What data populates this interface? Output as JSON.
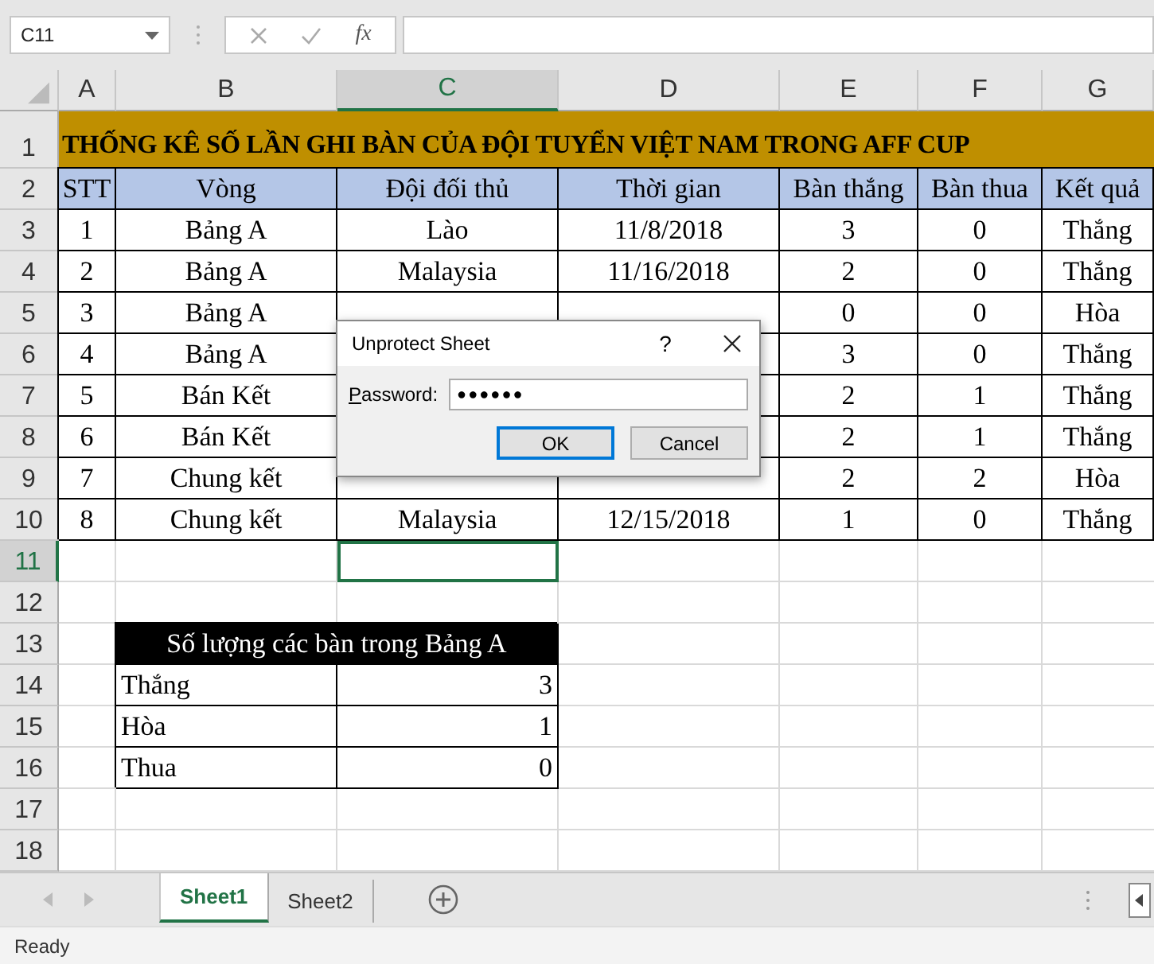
{
  "name_box": "C11",
  "formula_bar": {
    "function_label": "fx"
  },
  "columns": [
    {
      "label": "A",
      "selected": false
    },
    {
      "label": "B",
      "selected": false
    },
    {
      "label": "C",
      "selected": true
    },
    {
      "label": "D",
      "selected": false
    },
    {
      "label": "E",
      "selected": false
    },
    {
      "label": "F",
      "selected": false
    },
    {
      "label": "G",
      "selected": false
    }
  ],
  "rows": [
    {
      "label": "1",
      "selected": false
    },
    {
      "label": "2",
      "selected": false
    },
    {
      "label": "3",
      "selected": false
    },
    {
      "label": "4",
      "selected": false
    },
    {
      "label": "5",
      "selected": false
    },
    {
      "label": "6",
      "selected": false
    },
    {
      "label": "7",
      "selected": false
    },
    {
      "label": "8",
      "selected": false
    },
    {
      "label": "9",
      "selected": false
    },
    {
      "label": "10",
      "selected": false
    },
    {
      "label": "11",
      "selected": true
    },
    {
      "label": "12",
      "selected": false
    },
    {
      "label": "13",
      "selected": false
    },
    {
      "label": "14",
      "selected": false
    },
    {
      "label": "15",
      "selected": false
    },
    {
      "label": "16",
      "selected": false
    },
    {
      "label": "17",
      "selected": false
    },
    {
      "label": "18",
      "selected": false
    }
  ],
  "title": "THỐNG KÊ SỐ LẦN GHI BÀN CỦA ĐỘI TUYỂN VIỆT NAM TRONG AFF CUP",
  "table": {
    "columns": [
      "STT",
      "Vòng",
      "Đội đối thủ",
      "Thời gian",
      "Bàn thắng",
      "Bàn thua",
      "Kết quả"
    ],
    "rows": [
      [
        "1",
        "Bảng A",
        "Lào",
        "11/8/2018",
        "3",
        "0",
        "Thắng"
      ],
      [
        "2",
        "Bảng A",
        "Malaysia",
        "11/16/2018",
        "2",
        "0",
        "Thắng"
      ],
      [
        "3",
        "Bảng A",
        null,
        null,
        "0",
        "0",
        "Hòa"
      ],
      [
        "4",
        "Bảng A",
        null,
        null,
        "3",
        "0",
        "Thắng"
      ],
      [
        "5",
        "Bán Kết",
        null,
        null,
        "2",
        "1",
        "Thắng"
      ],
      [
        "6",
        "Bán Kết",
        null,
        null,
        "2",
        "1",
        "Thắng"
      ],
      [
        "7",
        "Chung kết",
        null,
        null,
        "2",
        "2",
        "Hòa"
      ],
      [
        "8",
        "Chung kết",
        "Malaysia",
        "12/15/2018",
        "1",
        "0",
        "Thắng"
      ]
    ]
  },
  "summary": {
    "title": "Số lượng các bàn trong Bảng A",
    "rows": [
      {
        "label": "Thắng",
        "value": "3"
      },
      {
        "label": "Hòa",
        "value": "1"
      },
      {
        "label": "Thua",
        "value": "0"
      }
    ]
  },
  "dialog": {
    "title": "Unprotect Sheet",
    "help": "?",
    "password_label": "Password:",
    "password_value": "●●●●●●",
    "buttons": [
      {
        "label": "OK",
        "default": true
      },
      {
        "label": "Cancel",
        "default": false
      }
    ]
  },
  "sheet_tabs": [
    {
      "label": "Sheet1",
      "selected": true
    },
    {
      "label": "Sheet2",
      "selected": false
    }
  ],
  "status": "Ready"
}
